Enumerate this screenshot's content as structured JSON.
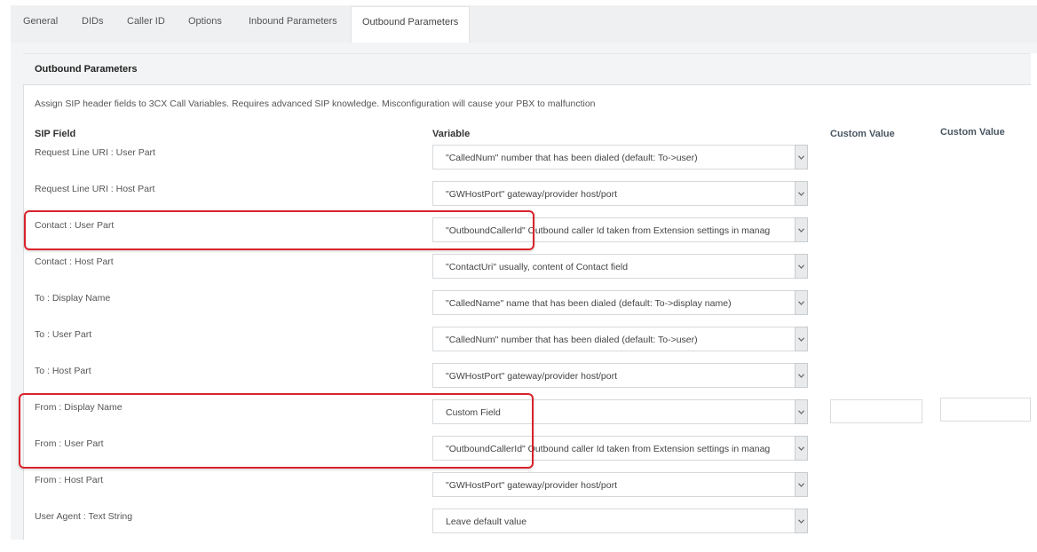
{
  "tabs": [
    {
      "label": "General",
      "active": false
    },
    {
      "label": "DIDs",
      "active": false
    },
    {
      "label": "Caller ID",
      "active": false
    },
    {
      "label": "Options",
      "active": false
    },
    {
      "label": "Inbound Parameters",
      "active": false
    },
    {
      "label": "Outbound Parameters",
      "active": true
    }
  ],
  "panel": {
    "title": "Outbound Parameters",
    "description": "Assign SIP header fields to 3CX Call Variables. Requires advanced SIP knowledge. Misconfiguration will cause your PBX to malfunction"
  },
  "columns": {
    "sip_field": "SIP Field",
    "variable": "Variable",
    "custom_value_1": "Custom Value",
    "custom_value_2": "Custom Value"
  },
  "rows": [
    {
      "sip_field": "Request Line URI : User Part",
      "variable": "\"CalledNum\" number that has been dialed (default: To->user)"
    },
    {
      "sip_field": "Request Line URI : Host Part",
      "variable": "\"GWHostPort\" gateway/provider host/port"
    },
    {
      "sip_field": "Contact : User Part",
      "variable": "\"OutboundCallerId\" Outbound caller Id taken from Extension settings in manag"
    },
    {
      "sip_field": "Contact : Host Part",
      "variable": "\"ContactUri\" usually, content of Contact field"
    },
    {
      "sip_field": "To : Display Name",
      "variable": "\"CalledName\" name that has been dialed (default: To->display name)"
    },
    {
      "sip_field": "To : User Part",
      "variable": "\"CalledNum\" number that has been dialed (default: To->user)"
    },
    {
      "sip_field": "To : Host Part",
      "variable": "\"GWHostPort\" gateway/provider host/port"
    },
    {
      "sip_field": "From : Display Name",
      "variable": "Custom Field",
      "custom_value_1": "",
      "custom_value_2": ""
    },
    {
      "sip_field": "From : User Part",
      "variable": "\"OutboundCallerId\" Outbound caller Id taken from Extension settings in manag"
    },
    {
      "sip_field": "From : Host Part",
      "variable": "\"GWHostPort\" gateway/provider host/port"
    },
    {
      "sip_field": "User Agent : Text String",
      "variable": "Leave default value"
    }
  ],
  "icons": {
    "select_arrow": "chevron-down-icon"
  },
  "colors": {
    "highlight": "#d9232b",
    "tab_bar": "#eff0f1",
    "panel_header": "#f3f4f5"
  }
}
